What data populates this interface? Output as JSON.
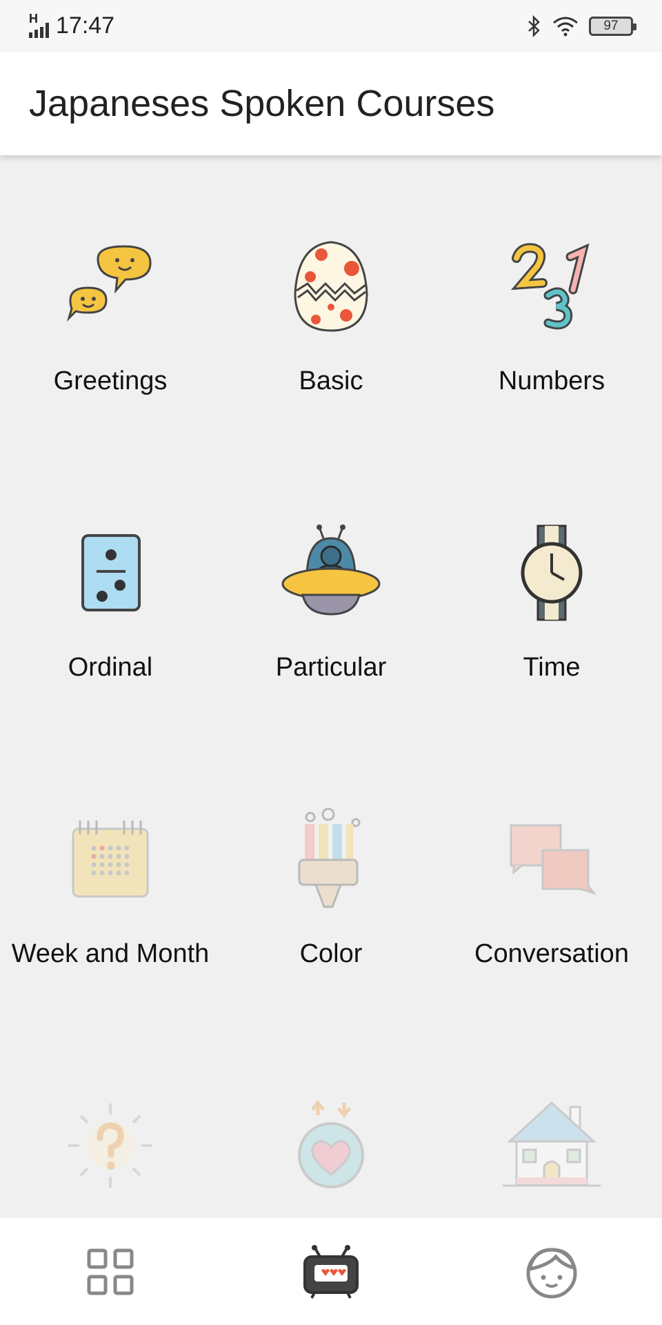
{
  "status_bar": {
    "network": "H",
    "time": "17:47",
    "battery": "97"
  },
  "app_bar": {
    "title": "Japaneses Spoken Courses"
  },
  "courses": [
    {
      "label": "Greetings",
      "icon": "speech-bubbles-smile-icon"
    },
    {
      "label": "Basic",
      "icon": "cracked-egg-icon"
    },
    {
      "label": "Numbers",
      "icon": "numbers-123-icon"
    },
    {
      "label": "Ordinal",
      "icon": "domino-icon"
    },
    {
      "label": "Particular",
      "icon": "ufo-alien-icon"
    },
    {
      "label": "Time",
      "icon": "wristwatch-icon"
    },
    {
      "label": "Week and Month",
      "icon": "calendar-icon"
    },
    {
      "label": "Color",
      "icon": "paintbrush-icon"
    },
    {
      "label": "Conversation",
      "icon": "chat-squares-icon"
    },
    {
      "label": "",
      "icon": "question-sun-icon"
    },
    {
      "label": "",
      "icon": "heart-circle-icon"
    },
    {
      "label": "",
      "icon": "house-icon"
    }
  ],
  "bottom_nav": [
    {
      "icon": "grid-icon"
    },
    {
      "icon": "tv-robot-icon"
    },
    {
      "icon": "boy-face-icon"
    }
  ],
  "colors": {
    "background": "#f0f0f0",
    "app_bar": "#ffffff",
    "accent_yellow": "#f5c542",
    "accent_red": "#e8573a",
    "accent_teal": "#5ec4c9",
    "outline": "#444444"
  }
}
